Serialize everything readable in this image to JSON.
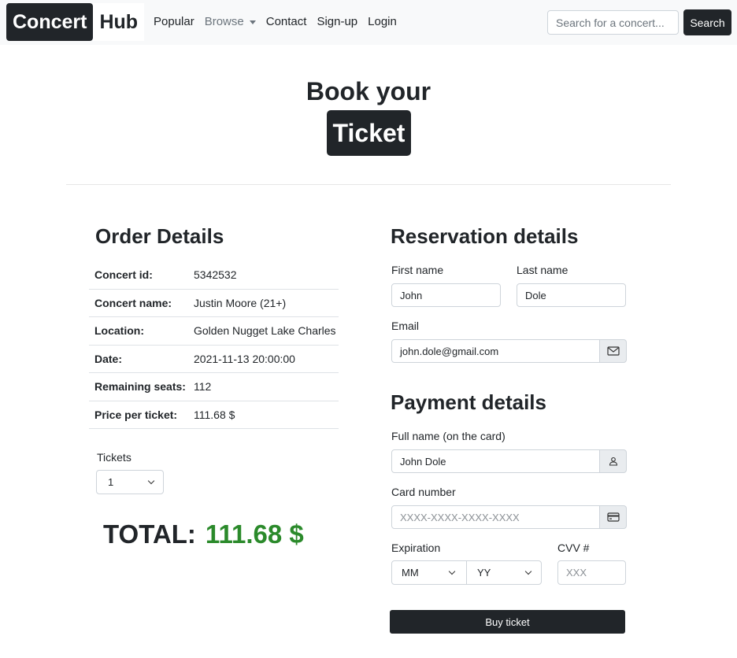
{
  "brand": {
    "part1": "Concert",
    "part2": "Hub"
  },
  "nav": {
    "popular": "Popular",
    "browse": "Browse",
    "contact": "Contact",
    "signup": "Sign-up",
    "login": "Login"
  },
  "search": {
    "placeholder": "Search for a concert...",
    "button": "Search"
  },
  "hero": {
    "line1": "Book your",
    "badge": "Ticket"
  },
  "order": {
    "title": "Order Details",
    "rows": [
      {
        "label": "Concert id:",
        "value": "5342532"
      },
      {
        "label": "Concert name:",
        "value": "Justin Moore (21+)"
      },
      {
        "label": "Location:",
        "value": "Golden Nugget Lake Charles"
      },
      {
        "label": "Date:",
        "value": "2021-11-13 20:00:00"
      },
      {
        "label": "Remaining seats:",
        "value": "112"
      },
      {
        "label": "Price per ticket:",
        "value": "111.68 $"
      }
    ],
    "tickets_label": "Tickets",
    "tickets_value": "1",
    "total_label": "TOTAL:",
    "total_value": "111.68 $"
  },
  "reservation": {
    "title": "Reservation details",
    "first_name_label": "First name",
    "first_name_value": "John",
    "last_name_label": "Last name",
    "last_name_value": "Dole",
    "email_label": "Email",
    "email_value": "john.dole@gmail.com"
  },
  "payment": {
    "title": "Payment details",
    "fullname_label": "Full name (on the card)",
    "fullname_value": "John Dole",
    "card_label": "Card number",
    "card_placeholder": "XXXX-XXXX-XXXX-XXXX",
    "expiration_label": "Expiration",
    "month_value": "MM",
    "year_value": "YY",
    "cvv_label": "CVV #",
    "cvv_placeholder": "XXX",
    "buy_button": "Buy ticket"
  },
  "colors": {
    "dark": "#212529",
    "total_green": "#2b8a2b",
    "navbar_bg": "#f8f9fa"
  }
}
